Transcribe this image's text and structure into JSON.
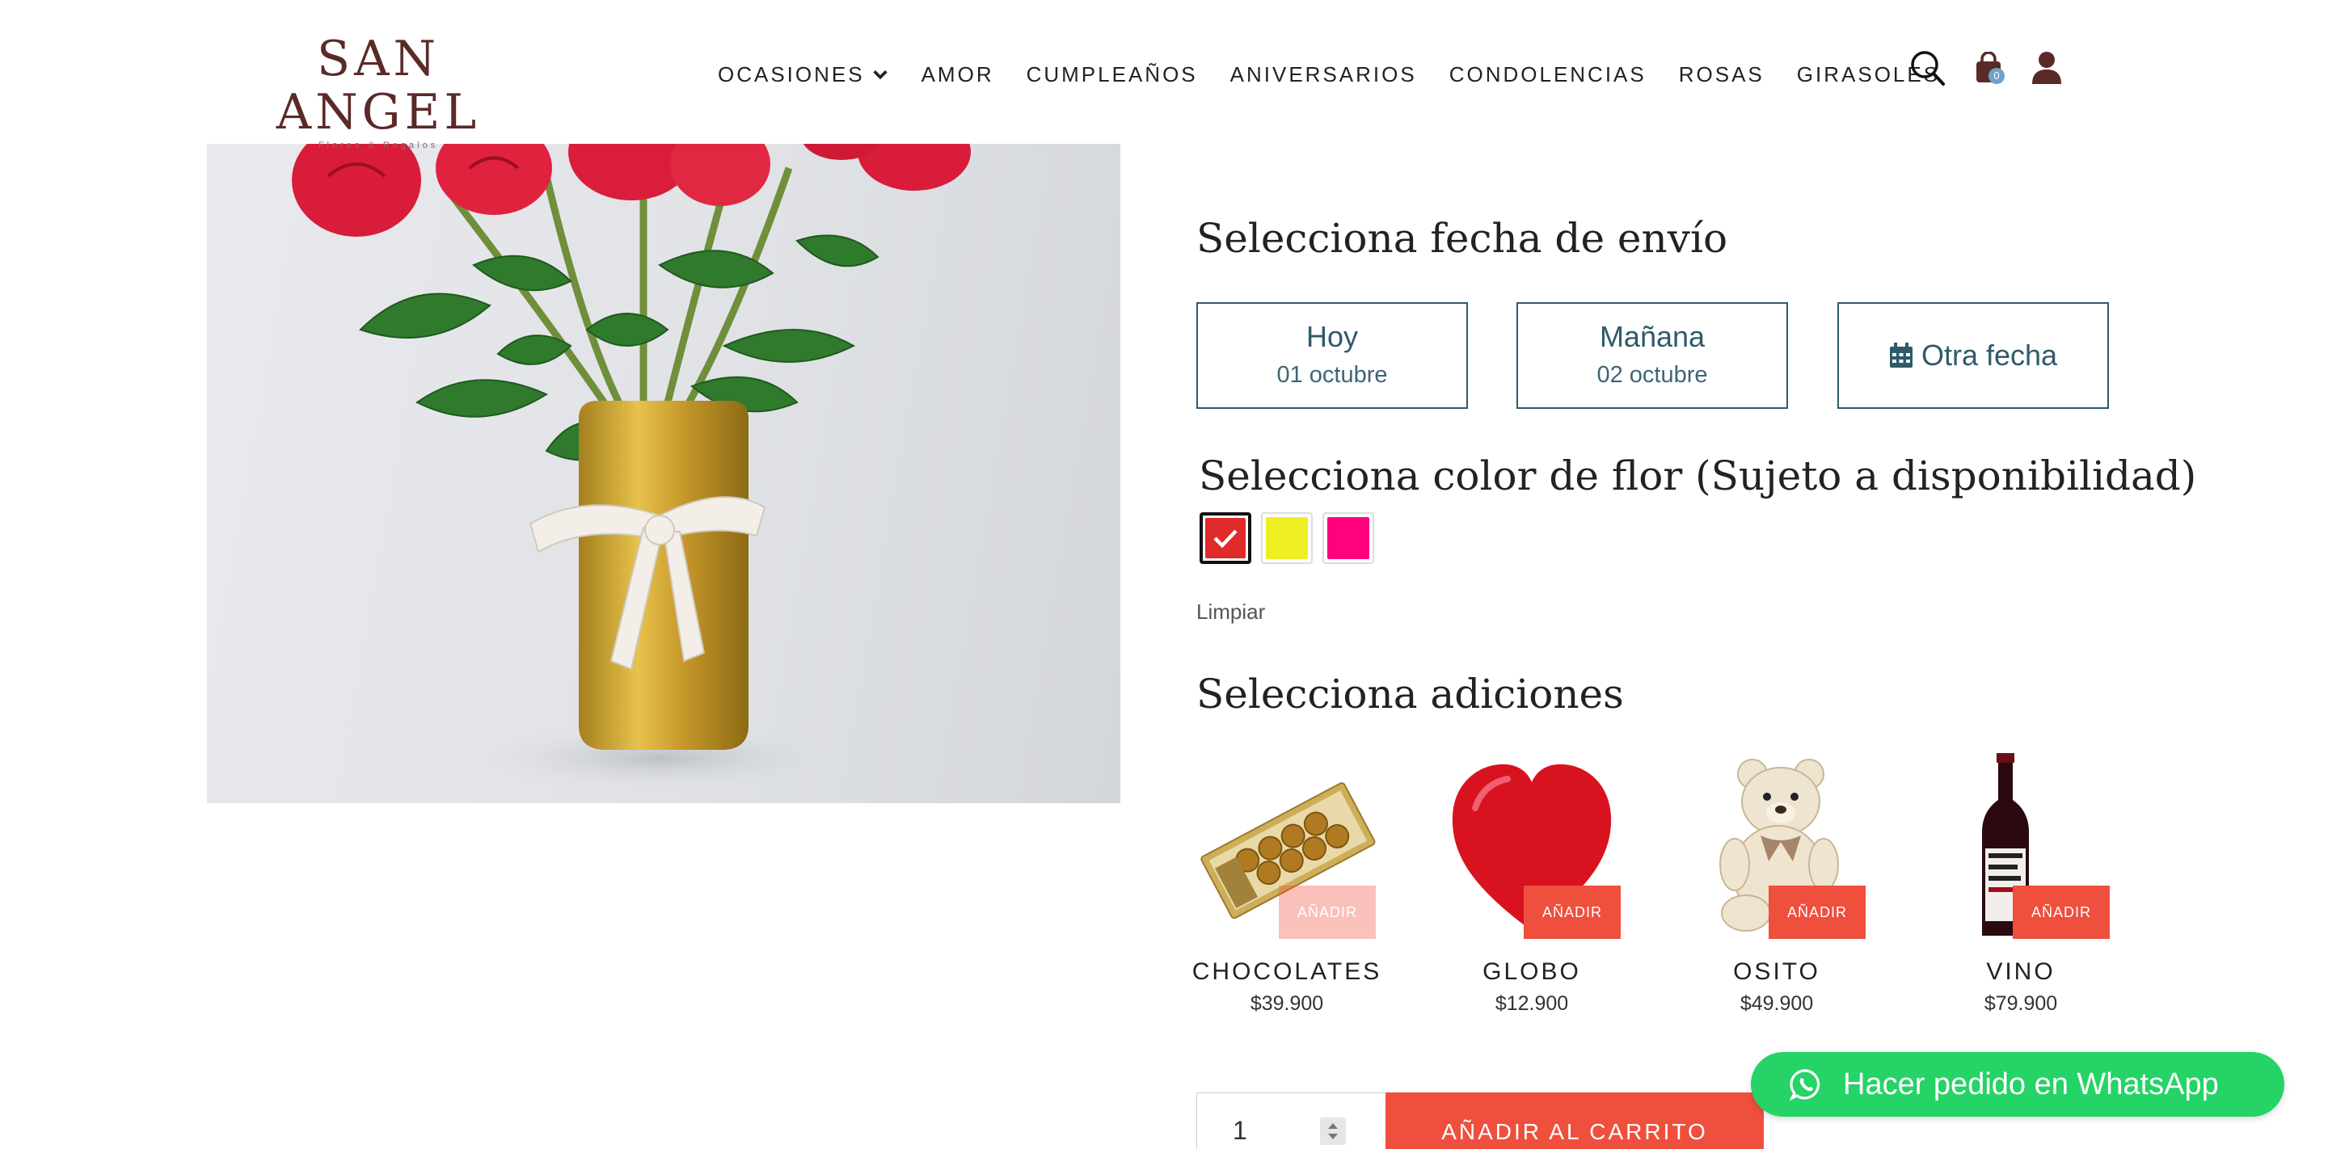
{
  "brand": {
    "name": "SAN ANGEL",
    "tagline": "Flores & Regalos"
  },
  "nav": {
    "items": [
      {
        "label": "OCASIONES",
        "has_dropdown": true
      },
      {
        "label": "AMOR"
      },
      {
        "label": "CUMPLEAÑOS"
      },
      {
        "label": "ANIVERSARIOS"
      },
      {
        "label": "CONDOLENCIAS"
      },
      {
        "label": "ROSAS"
      },
      {
        "label": "GIRASOLES"
      }
    ],
    "icons": [
      "search-icon",
      "shopping-bag-icon",
      "user-icon"
    ],
    "cart_count": "0"
  },
  "delivery": {
    "heading": "Selecciona fecha de envío",
    "options": [
      {
        "main": "Hoy",
        "sub": "01 octubre"
      },
      {
        "main": "Mañana",
        "sub": "02 octubre"
      },
      {
        "main": "Otra fecha",
        "icon": "calendar-icon"
      }
    ]
  },
  "color": {
    "heading": "Selecciona color de flor (Sujeto a disponibilidad)",
    "swatches": [
      {
        "color": "#e02b2b",
        "selected": true
      },
      {
        "color": "#eeee22",
        "selected": false
      },
      {
        "color": "#ff007f",
        "selected": false
      }
    ],
    "clear_label": "Limpiar"
  },
  "addons": {
    "heading": "Selecciona adiciones",
    "button_label": "AÑADIR",
    "items": [
      {
        "name": "CHOCOLATES",
        "price": "$39.900"
      },
      {
        "name": "GLOBO",
        "price": "$12.900"
      },
      {
        "name": "OSITO",
        "price": "$49.900"
      },
      {
        "name": "VINO",
        "price": "$79.900"
      }
    ]
  },
  "purchase": {
    "quantity": "1",
    "add_to_cart_label": "AÑADIR AL CARRITO"
  },
  "whatsapp": {
    "label": "Hacer pedido en WhatsApp"
  },
  "colors": {
    "accent": "#ef4f3d",
    "outline": "#2f5a6a",
    "whatsapp": "#25d366",
    "brand": "#5a2a27"
  }
}
